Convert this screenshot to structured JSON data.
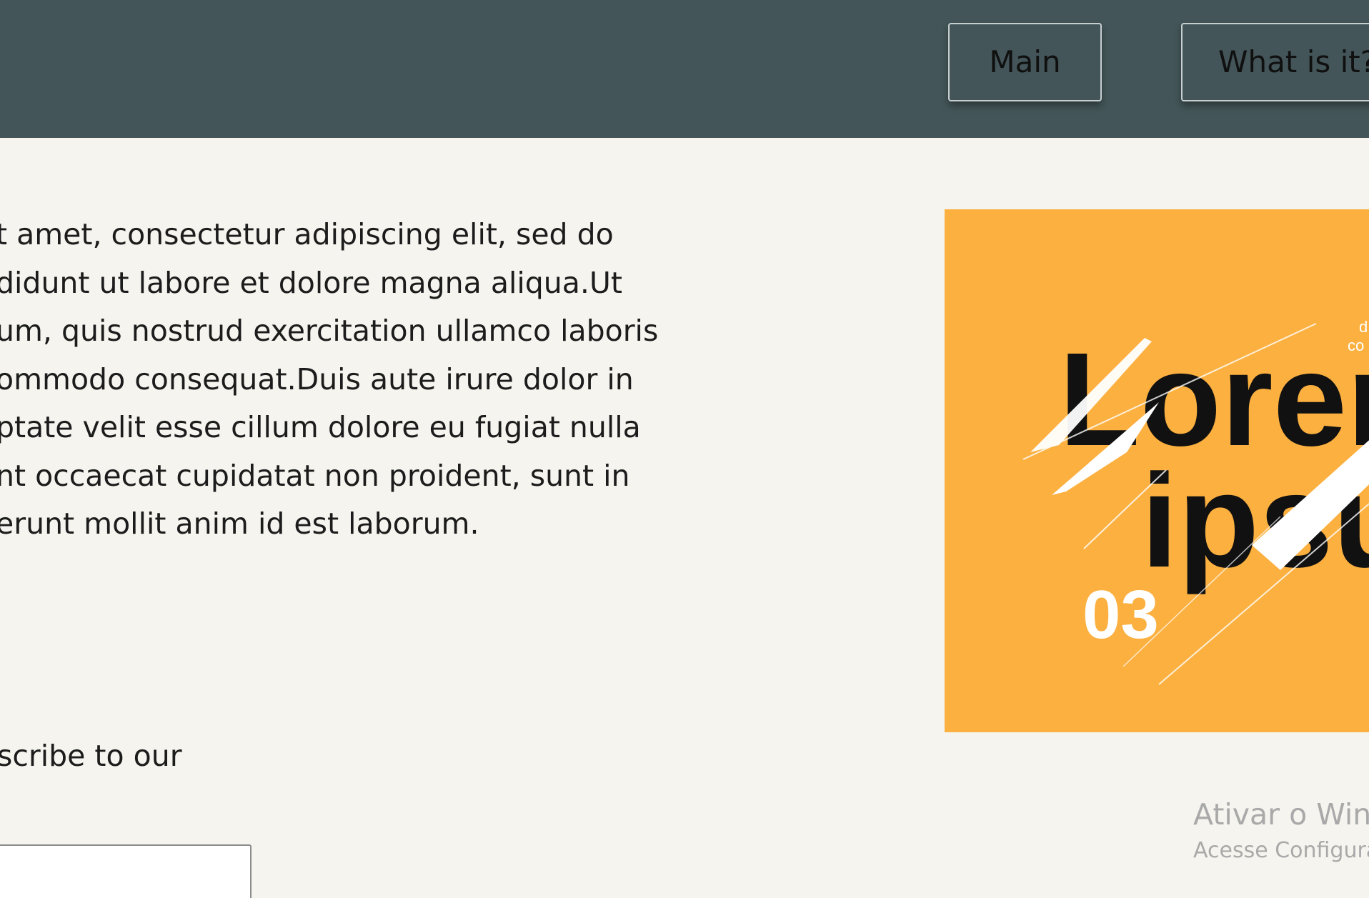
{
  "nav": {
    "main_label": "Main",
    "what_label": "What is it?"
  },
  "content": {
    "paragraph_lines": [
      "t amet, consectetur adipiscing elit, sed do",
      "didunt ut labore et dolore magna aliqua.Ut",
      "um, quis nostrud exercitation ullamco laboris",
      "ommodo consequat.Duis aute irure dolor in",
      "ptate velit esse cillum dolore eu fugiat nulla",
      "nt occaecat cupidatat non proident, sunt in",
      "erunt mollit anim id est laborum."
    ],
    "subscribe_text": "scribe to our"
  },
  "poster": {
    "word1": "Lorem",
    "word2": "ipsum",
    "number": "03",
    "small_text_1": "d",
    "small_text_2": "co",
    "background": "#fbb040"
  },
  "watermark": {
    "title": "Ativar o Windows",
    "subtitle": "Acesse Configurações para ativar o Windows."
  },
  "colors": {
    "header": "#435558",
    "page_background": "#f5f4ee",
    "poster": "#fbb040"
  }
}
